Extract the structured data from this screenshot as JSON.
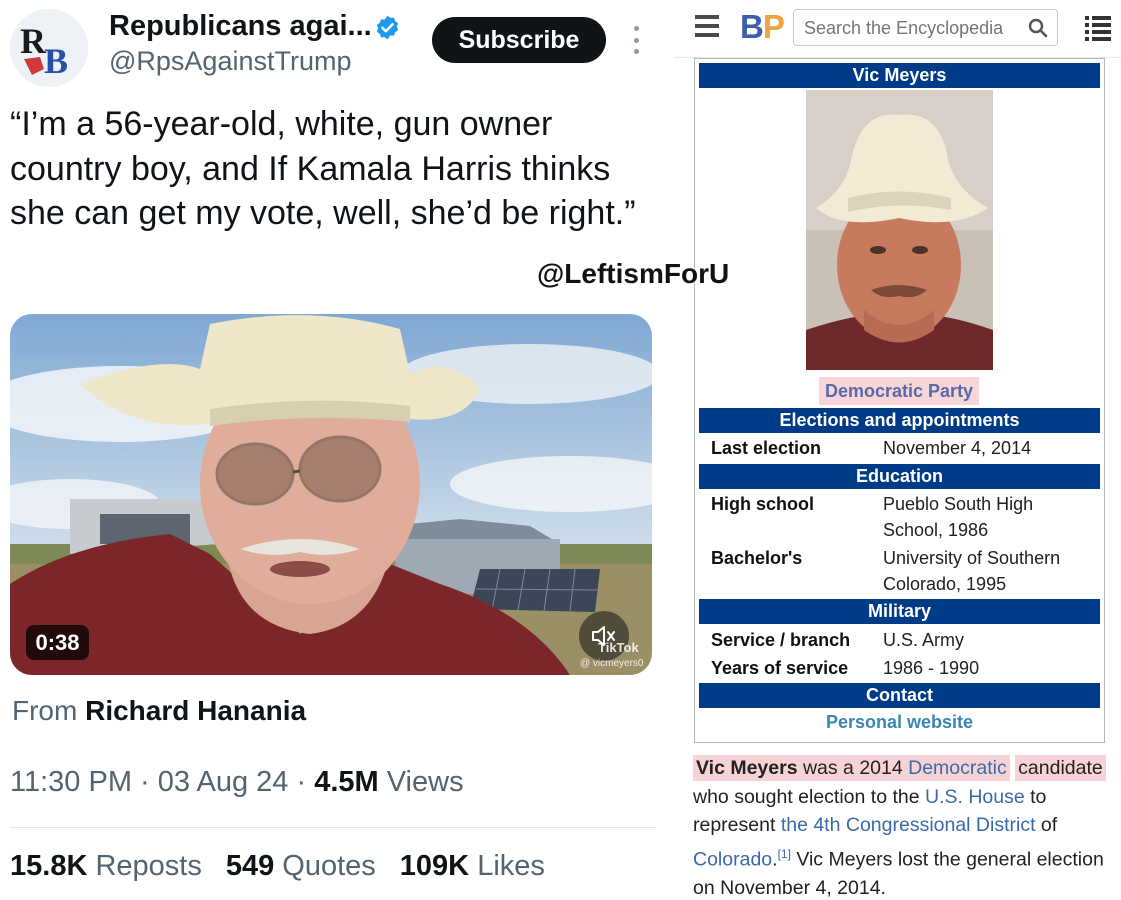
{
  "tweet": {
    "author_name": "Republicans agai...",
    "handle": "@RpsAgainstTrump",
    "avatar_initials": "RB",
    "subscribe_label": "Subscribe",
    "text": "“I’m a 56-year-old, white, gun owner country boy, and If Kamala Harris thinks she can get my vote, well, she’d be right.”",
    "video_duration": "0:38",
    "tiktok_label": "TikTok",
    "tiktok_user": "@ vicmeyers0",
    "from_label": "From",
    "from_name": "Richard Hanania",
    "time": "11:30 PM",
    "date": "03 Aug 24",
    "views_count": "4.5M",
    "views_label": "Views",
    "reposts_count": "15.8K",
    "reposts_label": "Reposts",
    "quotes_count": "549",
    "quotes_label": "Quotes",
    "likes_count": "109K",
    "likes_label": "Likes",
    "verified_color": "#1d9bf0",
    "icons": [
      "verified-badge-icon",
      "more-vertical-icon",
      "mute-icon"
    ]
  },
  "watermark": "@LeftismForU",
  "ballotpedia": {
    "logo_b": "B",
    "logo_p": "P",
    "search_placeholder": "Search the Encyclopedia",
    "icons": [
      "hamburger-menu-icon",
      "search-icon",
      "list-icon"
    ],
    "infobox": {
      "name": "Vic Meyers",
      "party": "Democratic Party",
      "sections": {
        "elections": "Elections and appointments",
        "education": "Education",
        "military": "Military",
        "contact": "Contact"
      },
      "last_election_label": "Last election",
      "last_election_value": "November 4, 2014",
      "high_school_label": "High school",
      "high_school_value": "Pueblo South High School, 1986",
      "bachelors_label": "Bachelor's",
      "bachelors_value": "University of Southern Colorado, 1995",
      "branch_label": "Service / branch",
      "branch_value": "U.S. Army",
      "years_label": "Years of service",
      "years_value": "1986 - 1990",
      "website_label": "Personal website",
      "header_color": "#003b87"
    },
    "paragraph": {
      "name": "Vic Meyers",
      "t1": " was a 2014 ",
      "party_link": "Democratic",
      "candidate": "candidate",
      "t2": " who sought election to the ",
      "house_link": "U.S. House",
      "t3": " to represent ",
      "district_link": "the 4th Congressional District",
      "t4": " of ",
      "state_link": "Colorado",
      "t5": ".",
      "ref": "[1]",
      "t6": " Vic Meyers lost the general election on November 4, 2014."
    }
  }
}
